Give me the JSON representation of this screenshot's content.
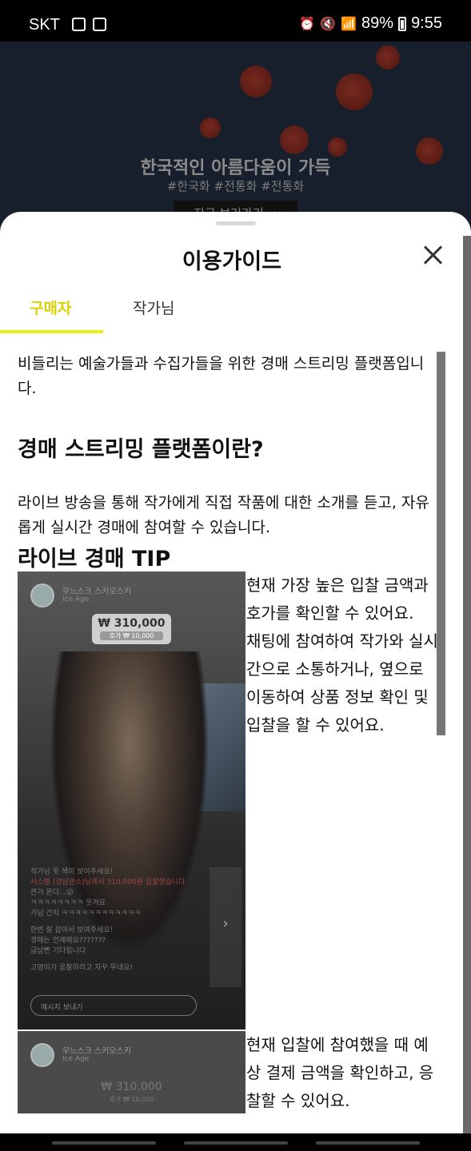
{
  "status_bar": {
    "carrier": "SKT",
    "battery": "89%",
    "time": "9:55"
  },
  "banner": {
    "title": "한국적인 아름다움이 가득",
    "tags": "#한국화 #전통화 #전통화",
    "button": "지금 보러가기 →"
  },
  "sheet": {
    "title": "이용가이드",
    "tabs": [
      {
        "label": "구매자",
        "active": true
      },
      {
        "label": "작가님",
        "active": false
      }
    ],
    "accent_color": "#e6f019"
  },
  "guide": {
    "intro": "비들리는 예술가들과 수집가들을 위한 경매 스트리밍 플랫폼입니다.",
    "heading_what": "경매 스트리밍 플랫폼이란?",
    "para_what": "라이브 방송을 통해 작가에게 직접 작품에 대한 소개를 듣고, 자유롭게 실시간 경매에 참여할 수 있습니다.",
    "heading_tip": "라이브 경매 TIP",
    "tip1": " 현재 가장 높은 입찰 금액과 호가를 확인할 수 있어요.\n채팅에 참여하여 작가와 실시간으로 소통하거나, 옆으로 이동하여 상품 정보 확인 및 입찰을 할 수 있어요.",
    "tip2": "현재 입찰에 참여했을 때 예상 결제 금액을 확인하고, 응찰할 수 있어요."
  },
  "screenshot": {
    "artist": "무느스크 스키오스키",
    "artwork": "Ice Age",
    "price": "₩ 310,000",
    "bid_unit": "호가  ₩ 10,000",
    "chat": [
      "작가님 옷 색이 보이주세요!",
      "사스템 (강남관소)님께서 310,000원 입찰했습니다",
      "큰거 온다...😮",
      "ㅋㅋㅋㅋㅋㅋㅋㅋ 웃겨요",
      "가님 건치 ㅋㅋㅋㅋㅋㅋㅋㅋㅋㅋㅋㅋ",
      "한번 잘 잡아서 보여주세요!",
      "경매는 언제에요???????",
      "급납빤 기다립니다",
      "고양이가 응찰하라고 자꾸 우네요!"
    ],
    "chat_placeholder": "메시지 보내기",
    "next_arrow": "›"
  }
}
